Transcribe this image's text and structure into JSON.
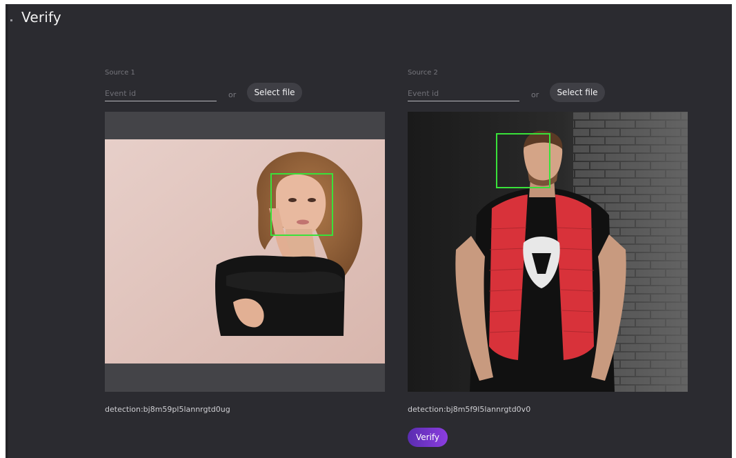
{
  "page": {
    "title": "Verify"
  },
  "sources": [
    {
      "label": "Source 1",
      "event_placeholder": "Event id",
      "event_value": "",
      "or_label": "or",
      "select_label": "Select file",
      "detection": "detection:bj8m59pl5lannrgtd0ug"
    },
    {
      "label": "Source 2",
      "event_placeholder": "Event id",
      "event_value": "",
      "or_label": "or",
      "select_label": "Select file",
      "detection": "detection:bj8m5f9l5lannrgtd0v0"
    }
  ],
  "actions": {
    "verify_label": "Verify"
  },
  "colors": {
    "background": "#2b2b30",
    "button": "#3f3f45",
    "verify_gradient_start": "#5a2db0",
    "verify_gradient_end": "#8b3ddf",
    "face_box": "#39e23a"
  }
}
